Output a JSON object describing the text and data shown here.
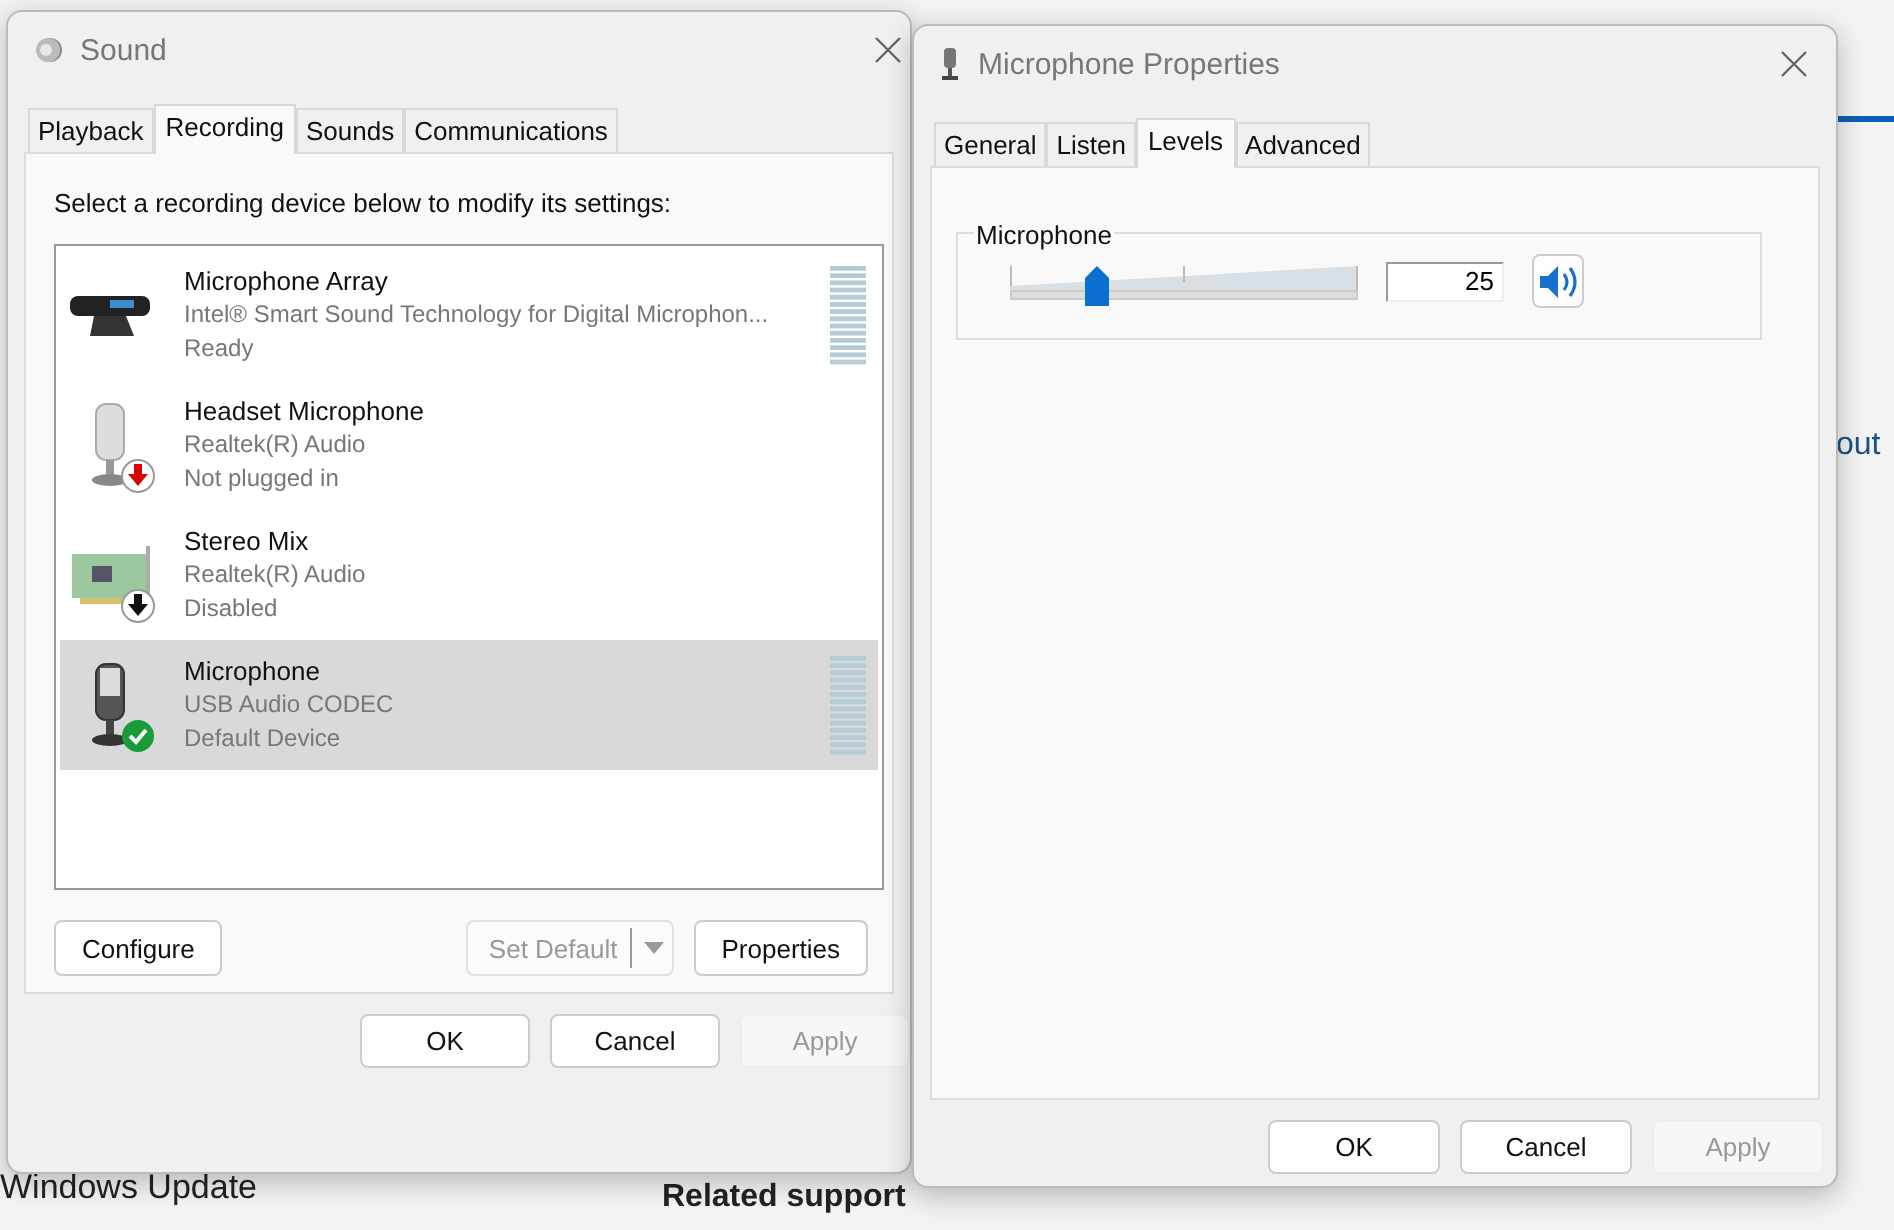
{
  "background": {
    "link_fragment": "out",
    "nav_item": "Windows Update",
    "section_heading": "Related support"
  },
  "sound_window": {
    "title": "Sound",
    "tabs": [
      {
        "label": "Playback",
        "selected": false
      },
      {
        "label": "Recording",
        "selected": true
      },
      {
        "label": "Sounds",
        "selected": false
      },
      {
        "label": "Communications",
        "selected": false
      }
    ],
    "instruction": "Select a recording device below to modify its settings:",
    "devices": [
      {
        "kind": "array",
        "name": "Microphone Array",
        "driver": "Intel® Smart Sound Technology for Digital Microphon...",
        "status": "Ready",
        "meter": true,
        "selected": false
      },
      {
        "kind": "headset",
        "name": "Headset Microphone",
        "driver": "Realtek(R) Audio",
        "status": "Not plugged in",
        "badge": {
          "kind": "unplugged"
        },
        "meter": false,
        "selected": false
      },
      {
        "kind": "card",
        "name": "Stereo Mix",
        "driver": "Realtek(R) Audio",
        "status": "Disabled",
        "badge": {
          "kind": "disabled"
        },
        "meter": false,
        "selected": false
      },
      {
        "kind": "mic",
        "name": "Microphone",
        "driver": "USB Audio CODEC",
        "status": "Default Device",
        "badge": {
          "kind": "default"
        },
        "meter": true,
        "selected": true
      }
    ],
    "configure_button": "Configure",
    "set_default_button": {
      "label": "Set Default",
      "disabled": true
    },
    "properties_button": "Properties",
    "buttons": [
      {
        "label": "OK",
        "disabled": false
      },
      {
        "label": "Cancel",
        "disabled": false
      },
      {
        "label": "Apply",
        "disabled": true
      }
    ]
  },
  "properties_window": {
    "title": "Microphone Properties",
    "tabs": [
      {
        "label": "General",
        "selected": false
      },
      {
        "label": "Listen",
        "selected": false
      },
      {
        "label": "Levels",
        "selected": true
      },
      {
        "label": "Advanced",
        "selected": false
      }
    ],
    "group_label": "Microphone",
    "slider": {
      "level": 0.25
    },
    "value": "25",
    "muted": false,
    "buttons": [
      {
        "label": "OK",
        "disabled": false
      },
      {
        "label": "Cancel",
        "disabled": false
      },
      {
        "label": "Apply",
        "disabled": true
      }
    ]
  }
}
